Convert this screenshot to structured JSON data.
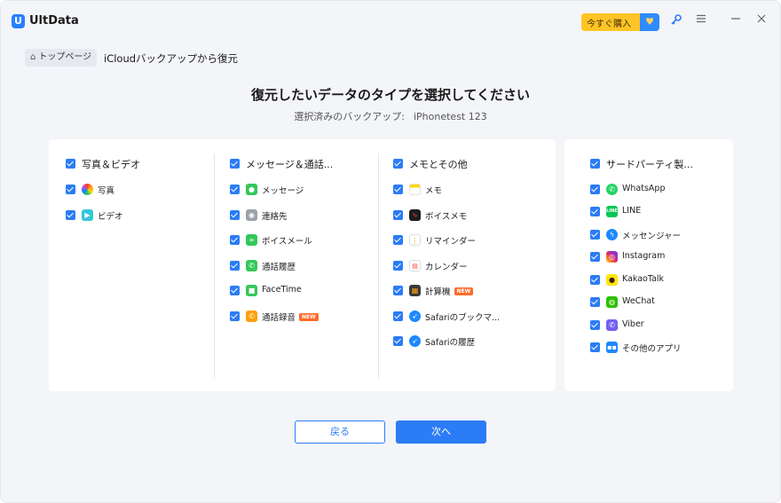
{
  "app": {
    "logo": "U",
    "name": "UltData"
  },
  "toolbar": {
    "buy_label": "今すぐ購入",
    "buy_badge_icon": "heart-tag-icon",
    "key_icon": "key-icon",
    "menu_icon": "menu-icon",
    "minimize_icon": "minimize-icon",
    "close_icon": "close-icon"
  },
  "breadcrumb": {
    "home": "トップページ",
    "current": "iCloudバックアップから復元"
  },
  "header": {
    "title": "復元したいデータのタイプを選択してください",
    "backup_label": "選択済みのバックアップ:",
    "backup_name": "iPhonetest 123"
  },
  "columns": [
    {
      "title": "写真＆ビデオ",
      "items": [
        {
          "label": "写真",
          "icon": "photos-icon",
          "color": "#ff9f0a"
        },
        {
          "label": "ビデオ",
          "icon": "video-icon",
          "color": "#34c7d9"
        }
      ]
    },
    {
      "title": "メッセージ＆通話...",
      "items": [
        {
          "label": "メッセージ",
          "icon": "messages-icon",
          "color": "#34c759"
        },
        {
          "label": "連絡先",
          "icon": "contacts-icon",
          "color": "#9aa1aa"
        },
        {
          "label": "ボイスメール",
          "icon": "voicemail-icon",
          "color": "#34c759"
        },
        {
          "label": "通話履歴",
          "icon": "phone-icon",
          "color": "#34c759"
        },
        {
          "label": "FaceTime",
          "icon": "facetime-icon",
          "color": "#34c759"
        },
        {
          "label": "通話録音",
          "icon": "call-recording-icon",
          "color": "#ff9f0a",
          "badge": "NEW"
        }
      ]
    },
    {
      "title": "メモとその他",
      "items": [
        {
          "label": "メモ",
          "icon": "notes-icon",
          "color": "#ffd60a"
        },
        {
          "label": "ボイスメモ",
          "icon": "voice-memos-icon",
          "color": "#1c1c1e"
        },
        {
          "label": "リマインダー",
          "icon": "reminders-icon",
          "color": "#d8dce2"
        },
        {
          "label": "カレンダー",
          "icon": "calendar-icon",
          "color": "#ff3b30"
        },
        {
          "label": "計算機",
          "icon": "calculator-icon",
          "color": "#3a3a3c",
          "badge": "NEW"
        },
        {
          "label": "Safariのブックマ...",
          "icon": "safari-icon",
          "color": "#1e88ff"
        },
        {
          "label": "Safariの履歴",
          "icon": "safari-icon",
          "color": "#1e88ff"
        }
      ]
    },
    {
      "title": "サードパーティ製...",
      "items": [
        {
          "label": "WhatsApp",
          "icon": "whatsapp-icon",
          "color": "#25d366"
        },
        {
          "label": "LINE",
          "icon": "line-icon",
          "color": "#06c755"
        },
        {
          "label": "メッセンジャー",
          "icon": "messenger-icon",
          "color": "#1e88ff"
        },
        {
          "label": "Instagram",
          "icon": "instagram-icon",
          "color": "#e1306c"
        },
        {
          "label": "KakaoTalk",
          "icon": "kakaotalk-icon",
          "color": "#fee500"
        },
        {
          "label": "WeChat",
          "icon": "wechat-icon",
          "color": "#2dc100"
        },
        {
          "label": "Viber",
          "icon": "viber-icon",
          "color": "#7360f2"
        },
        {
          "label": "その他のアプリ",
          "icon": "other-apps-icon",
          "color": "#1e88ff"
        }
      ]
    }
  ],
  "buttons": {
    "back": "戻る",
    "next": "次へ"
  },
  "colors": {
    "accent": "#2b7cf6",
    "buy": "#ffc425"
  }
}
